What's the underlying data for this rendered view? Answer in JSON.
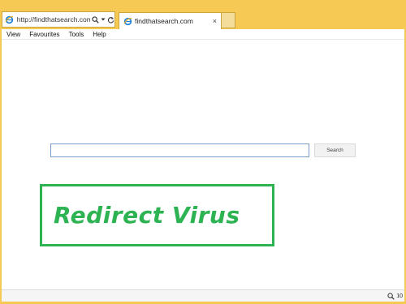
{
  "browser": {
    "address_url": "http://findthatsearch.com/",
    "tab_title": "findthatsearch.com",
    "icons": {
      "site": "ie-icon",
      "search": "search-icon",
      "dropdown": "dropdown-icon",
      "refresh": "refresh-icon",
      "close": "close-icon",
      "zoom": "zoom-icon"
    },
    "close_glyph": "×",
    "frame_color": "#f6c955"
  },
  "menu": {
    "items": [
      "View",
      "Favourites",
      "Tools",
      "Help"
    ]
  },
  "page": {
    "search_placeholder": "",
    "search_value": "",
    "search_button": "Search"
  },
  "overlay": {
    "text": "Redirect Virus",
    "color": "#2eb352"
  },
  "status": {
    "zoom_text": "10"
  }
}
